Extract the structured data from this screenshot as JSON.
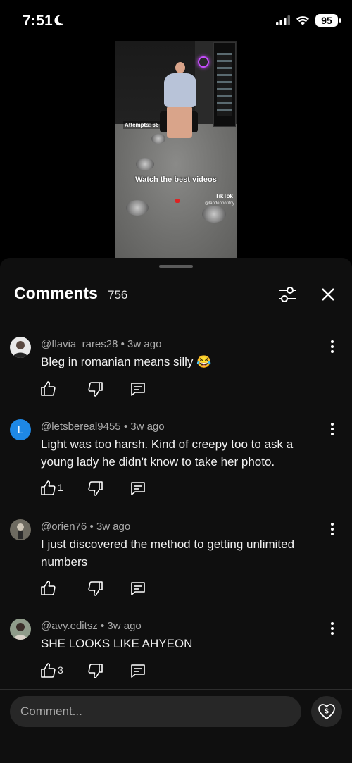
{
  "status_bar": {
    "time": "7:51",
    "battery": "95"
  },
  "video": {
    "overlay_attempts": "Attempts: 66",
    "overlay_caption": "Watch the best videos",
    "watermark_brand": "TikTok",
    "watermark_handle": "@landenporifoy"
  },
  "comments_panel": {
    "title": "Comments",
    "count": "756",
    "comments": [
      {
        "author": "@flavia_rares28",
        "age": "3w ago",
        "text": "Bleg in romanian means silly 😂",
        "likes": ""
      },
      {
        "author": "@letsbereal9455",
        "age": "3w ago",
        "text": "Light was too harsh.  Kind of creepy too to ask a young lady he didn't know to take her photo.",
        "likes": "1",
        "avatar_letter": "L"
      },
      {
        "author": "@orien76",
        "age": "3w ago",
        "text": "I just discovered the method to getting unlimited numbers",
        "likes": ""
      },
      {
        "author": "@avy.editsz",
        "age": "3w ago",
        "text": "SHE LOOKS LIKE AHYEON",
        "likes": "3"
      }
    ],
    "composer": {
      "placeholder": "Comment..."
    }
  },
  "icons": {
    "moon": "moon-icon",
    "signal": "signal-icon",
    "wifi": "wifi-icon",
    "filter": "sliders-icon",
    "close": "close-icon",
    "more": "more-vertical-icon",
    "like": "thumbs-up-icon",
    "dislike": "thumbs-down-icon",
    "reply": "reply-icon",
    "thanks": "heart-dollar-icon"
  },
  "colors": {
    "sheet_bg": "#0f0f0f",
    "avatar_letter_bg": "#1e88e5",
    "muted_text": "#aaaaaa"
  }
}
